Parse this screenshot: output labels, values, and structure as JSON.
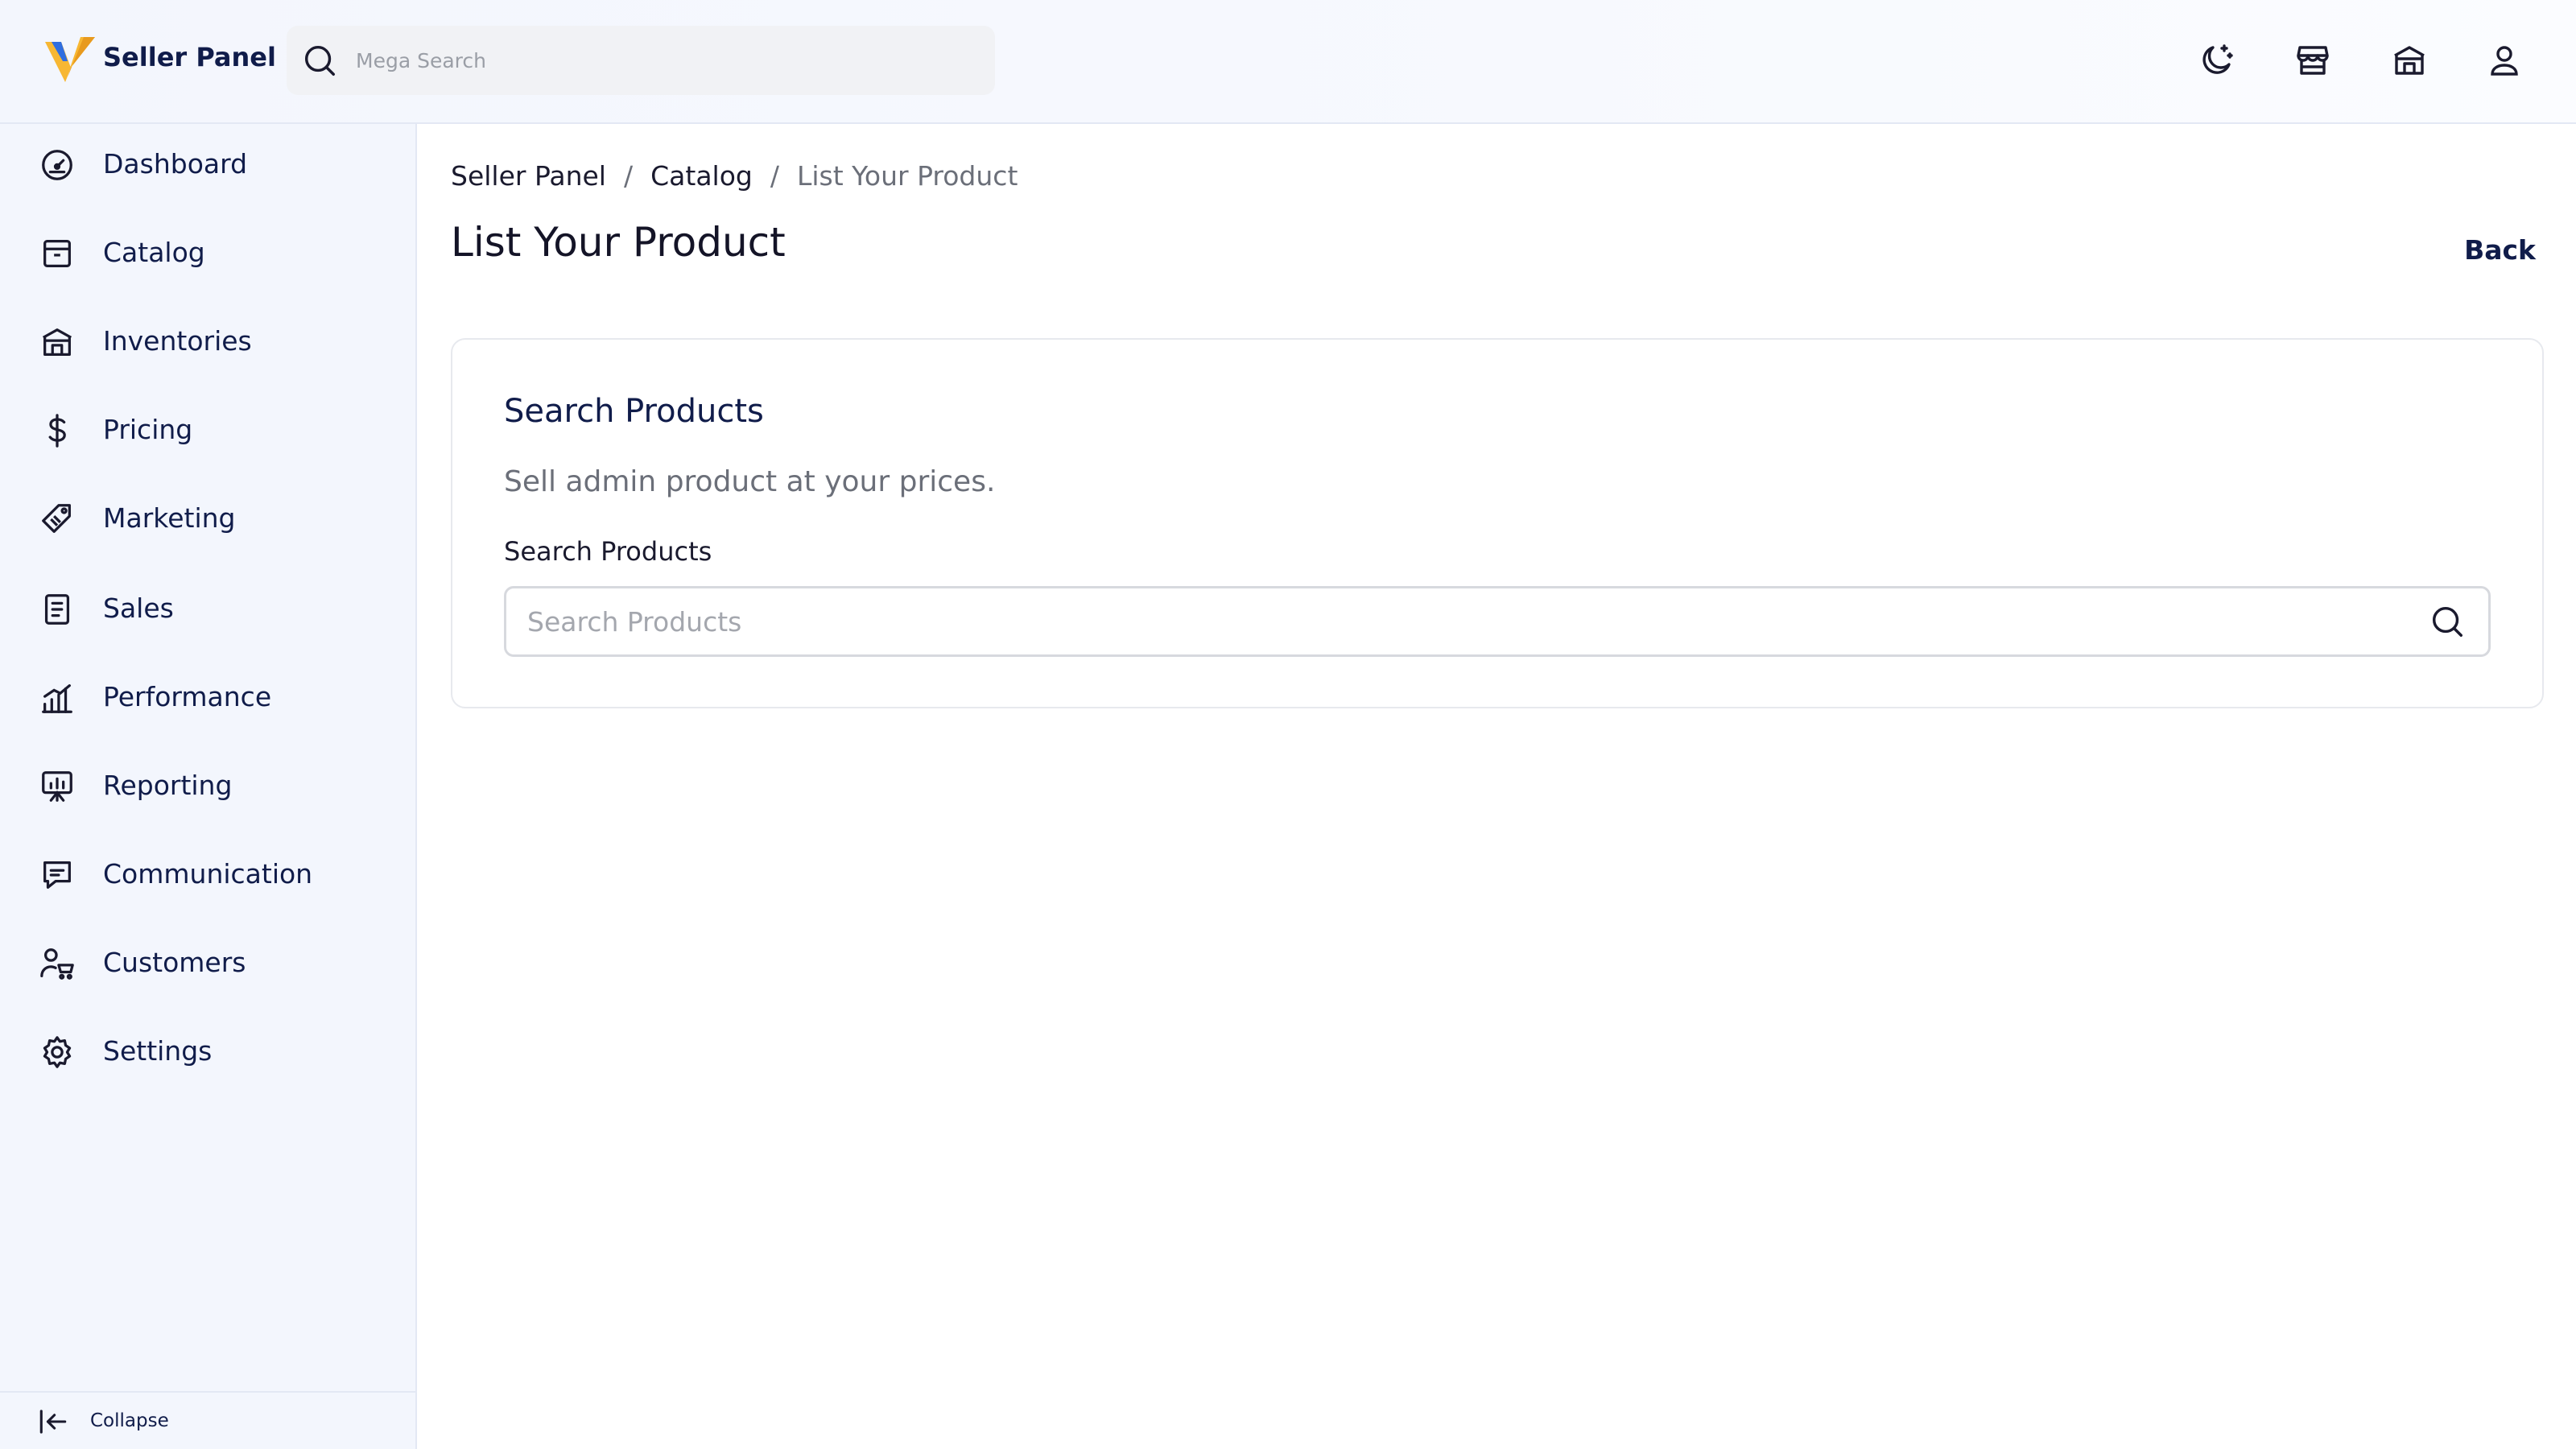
{
  "header": {
    "brand": "Seller Panel",
    "search_placeholder": "Mega Search",
    "icons": [
      "theme-toggle-icon",
      "store-icon",
      "warehouse-icon",
      "user-icon"
    ]
  },
  "sidebar": {
    "items": [
      {
        "label": "Dashboard",
        "icon": "dashboard-gauge-icon"
      },
      {
        "label": "Catalog",
        "icon": "catalog-box-icon"
      },
      {
        "label": "Inventories",
        "icon": "warehouse-icon"
      },
      {
        "label": "Pricing",
        "icon": "dollar-icon"
      },
      {
        "label": "Marketing",
        "icon": "tag-icon"
      },
      {
        "label": "Sales",
        "icon": "receipt-icon"
      },
      {
        "label": "Performance",
        "icon": "bar-chart-icon"
      },
      {
        "label": "Reporting",
        "icon": "presentation-chart-icon"
      },
      {
        "label": "Communication",
        "icon": "message-icon"
      },
      {
        "label": "Customers",
        "icon": "customer-cart-icon"
      },
      {
        "label": "Settings",
        "icon": "gear-icon"
      }
    ],
    "collapse_label": "Collapse"
  },
  "breadcrumb": {
    "items": [
      "Seller Panel",
      "Catalog"
    ],
    "separator": "/",
    "current": "List Your Product"
  },
  "page": {
    "title": "List Your Product",
    "back_label": "Back"
  },
  "card": {
    "title": "Search Products",
    "subtitle": "Sell admin product at your prices.",
    "field_label": "Search Products",
    "field_placeholder": "Search Products"
  },
  "colors": {
    "brand_navy": "#101c4a",
    "logo_yellow": "#f7b733",
    "logo_blue": "#2f6ee0",
    "sidebar_bg": "#f3f6fd",
    "muted_text": "#6b6f79"
  }
}
